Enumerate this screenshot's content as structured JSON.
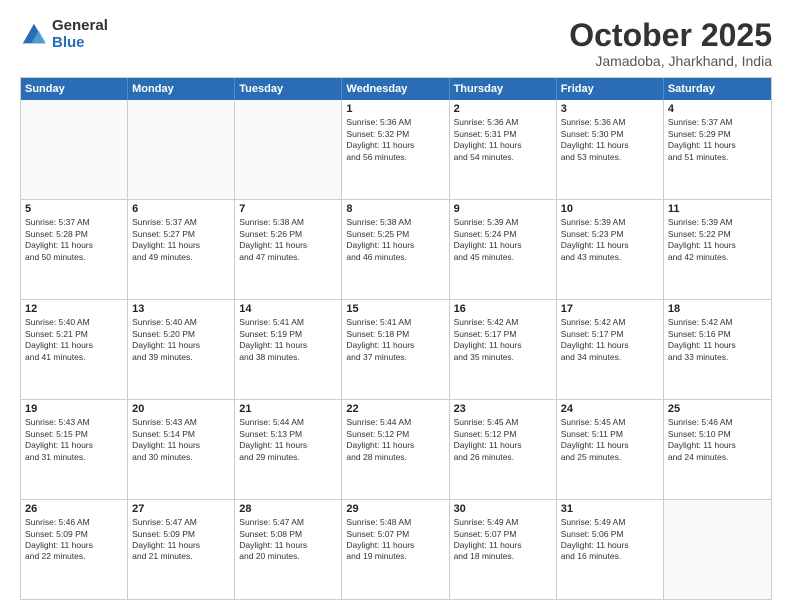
{
  "logo": {
    "general": "General",
    "blue": "Blue"
  },
  "title": "October 2025",
  "subtitle": "Jamadoba, Jharkhand, India",
  "days_of_week": [
    "Sunday",
    "Monday",
    "Tuesday",
    "Wednesday",
    "Thursday",
    "Friday",
    "Saturday"
  ],
  "weeks": [
    [
      {
        "day": "",
        "content": ""
      },
      {
        "day": "",
        "content": ""
      },
      {
        "day": "",
        "content": ""
      },
      {
        "day": "1",
        "content": "Sunrise: 5:36 AM\nSunset: 5:32 PM\nDaylight: 11 hours\nand 56 minutes."
      },
      {
        "day": "2",
        "content": "Sunrise: 5:36 AM\nSunset: 5:31 PM\nDaylight: 11 hours\nand 54 minutes."
      },
      {
        "day": "3",
        "content": "Sunrise: 5:36 AM\nSunset: 5:30 PM\nDaylight: 11 hours\nand 53 minutes."
      },
      {
        "day": "4",
        "content": "Sunrise: 5:37 AM\nSunset: 5:29 PM\nDaylight: 11 hours\nand 51 minutes."
      }
    ],
    [
      {
        "day": "5",
        "content": "Sunrise: 5:37 AM\nSunset: 5:28 PM\nDaylight: 11 hours\nand 50 minutes."
      },
      {
        "day": "6",
        "content": "Sunrise: 5:37 AM\nSunset: 5:27 PM\nDaylight: 11 hours\nand 49 minutes."
      },
      {
        "day": "7",
        "content": "Sunrise: 5:38 AM\nSunset: 5:26 PM\nDaylight: 11 hours\nand 47 minutes."
      },
      {
        "day": "8",
        "content": "Sunrise: 5:38 AM\nSunset: 5:25 PM\nDaylight: 11 hours\nand 46 minutes."
      },
      {
        "day": "9",
        "content": "Sunrise: 5:39 AM\nSunset: 5:24 PM\nDaylight: 11 hours\nand 45 minutes."
      },
      {
        "day": "10",
        "content": "Sunrise: 5:39 AM\nSunset: 5:23 PM\nDaylight: 11 hours\nand 43 minutes."
      },
      {
        "day": "11",
        "content": "Sunrise: 5:39 AM\nSunset: 5:22 PM\nDaylight: 11 hours\nand 42 minutes."
      }
    ],
    [
      {
        "day": "12",
        "content": "Sunrise: 5:40 AM\nSunset: 5:21 PM\nDaylight: 11 hours\nand 41 minutes."
      },
      {
        "day": "13",
        "content": "Sunrise: 5:40 AM\nSunset: 5:20 PM\nDaylight: 11 hours\nand 39 minutes."
      },
      {
        "day": "14",
        "content": "Sunrise: 5:41 AM\nSunset: 5:19 PM\nDaylight: 11 hours\nand 38 minutes."
      },
      {
        "day": "15",
        "content": "Sunrise: 5:41 AM\nSunset: 5:18 PM\nDaylight: 11 hours\nand 37 minutes."
      },
      {
        "day": "16",
        "content": "Sunrise: 5:42 AM\nSunset: 5:17 PM\nDaylight: 11 hours\nand 35 minutes."
      },
      {
        "day": "17",
        "content": "Sunrise: 5:42 AM\nSunset: 5:17 PM\nDaylight: 11 hours\nand 34 minutes."
      },
      {
        "day": "18",
        "content": "Sunrise: 5:42 AM\nSunset: 5:16 PM\nDaylight: 11 hours\nand 33 minutes."
      }
    ],
    [
      {
        "day": "19",
        "content": "Sunrise: 5:43 AM\nSunset: 5:15 PM\nDaylight: 11 hours\nand 31 minutes."
      },
      {
        "day": "20",
        "content": "Sunrise: 5:43 AM\nSunset: 5:14 PM\nDaylight: 11 hours\nand 30 minutes."
      },
      {
        "day": "21",
        "content": "Sunrise: 5:44 AM\nSunset: 5:13 PM\nDaylight: 11 hours\nand 29 minutes."
      },
      {
        "day": "22",
        "content": "Sunrise: 5:44 AM\nSunset: 5:12 PM\nDaylight: 11 hours\nand 28 minutes."
      },
      {
        "day": "23",
        "content": "Sunrise: 5:45 AM\nSunset: 5:12 PM\nDaylight: 11 hours\nand 26 minutes."
      },
      {
        "day": "24",
        "content": "Sunrise: 5:45 AM\nSunset: 5:11 PM\nDaylight: 11 hours\nand 25 minutes."
      },
      {
        "day": "25",
        "content": "Sunrise: 5:46 AM\nSunset: 5:10 PM\nDaylight: 11 hours\nand 24 minutes."
      }
    ],
    [
      {
        "day": "26",
        "content": "Sunrise: 5:46 AM\nSunset: 5:09 PM\nDaylight: 11 hours\nand 22 minutes."
      },
      {
        "day": "27",
        "content": "Sunrise: 5:47 AM\nSunset: 5:09 PM\nDaylight: 11 hours\nand 21 minutes."
      },
      {
        "day": "28",
        "content": "Sunrise: 5:47 AM\nSunset: 5:08 PM\nDaylight: 11 hours\nand 20 minutes."
      },
      {
        "day": "29",
        "content": "Sunrise: 5:48 AM\nSunset: 5:07 PM\nDaylight: 11 hours\nand 19 minutes."
      },
      {
        "day": "30",
        "content": "Sunrise: 5:49 AM\nSunset: 5:07 PM\nDaylight: 11 hours\nand 18 minutes."
      },
      {
        "day": "31",
        "content": "Sunrise: 5:49 AM\nSunset: 5:06 PM\nDaylight: 11 hours\nand 16 minutes."
      },
      {
        "day": "",
        "content": ""
      }
    ]
  ]
}
